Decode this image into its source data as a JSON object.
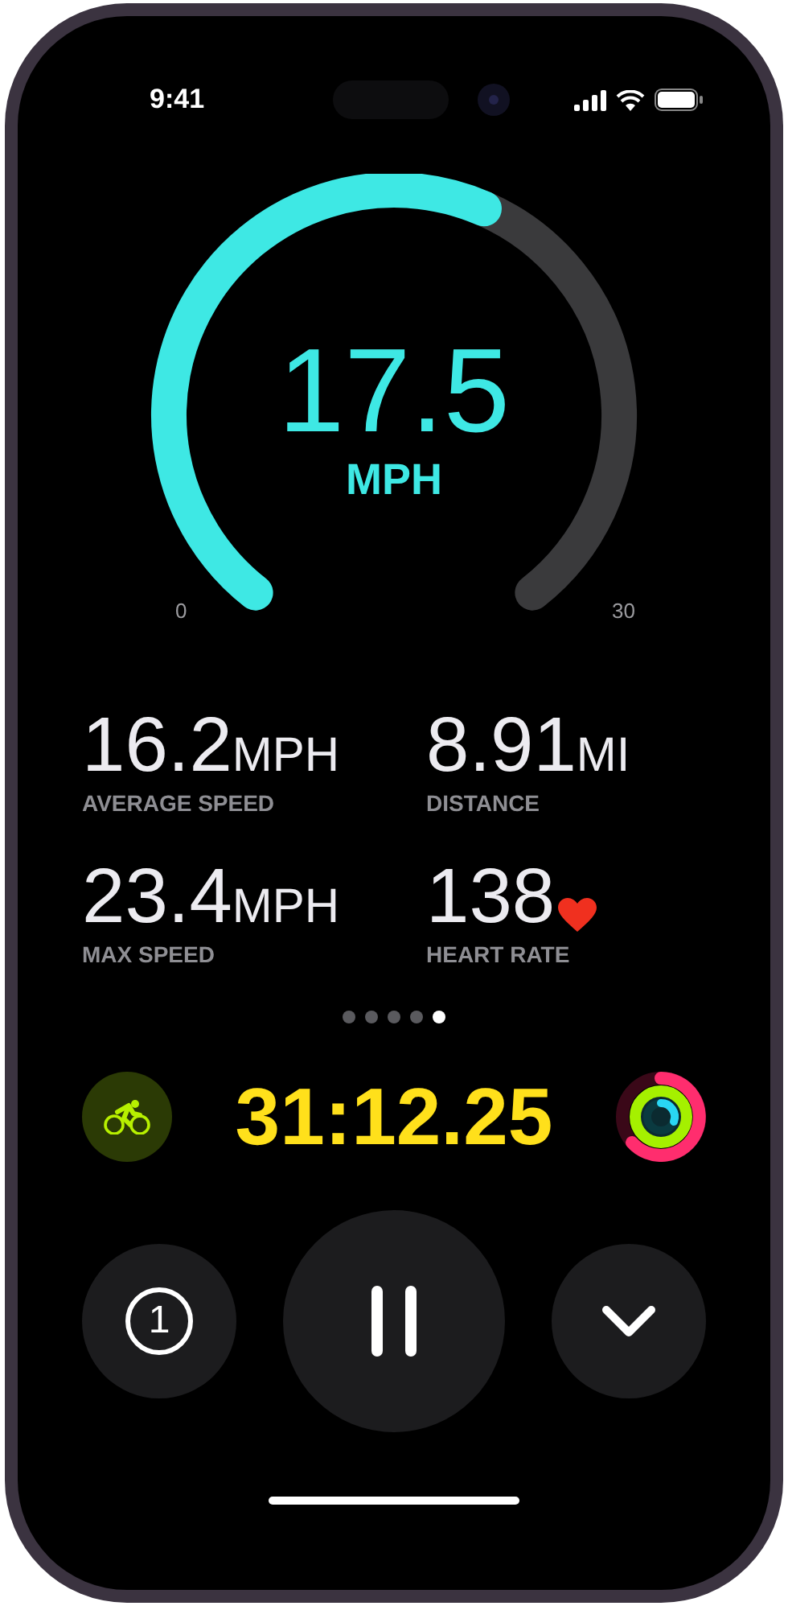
{
  "status_bar": {
    "time": "9:41"
  },
  "gauge": {
    "value": "17.5",
    "unit": "MPH",
    "min_label": "0",
    "max_label": "30"
  },
  "metrics": [
    {
      "kind": "unit",
      "value": "16.2",
      "unit": "MPH",
      "label": "AVERAGE SPEED"
    },
    {
      "kind": "unit",
      "value": "8.91",
      "unit": "MI",
      "label": "DISTANCE"
    },
    {
      "kind": "unit",
      "value": "23.4",
      "unit": "MPH",
      "label": "MAX SPEED"
    },
    {
      "kind": "heart",
      "value": "138",
      "label": "HEART RATE"
    }
  ],
  "page_dots": [
    {
      "selected": false
    },
    {
      "selected": false
    },
    {
      "selected": false
    },
    {
      "selected": false
    },
    {
      "selected": true
    }
  ],
  "timer": "31:12.25",
  "controls": {
    "segment_label": "1"
  }
}
